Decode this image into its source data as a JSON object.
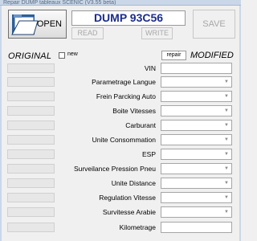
{
  "window": {
    "title": "Repair DUMP tableaux SCENIC (V3.55 beta)"
  },
  "toolbar": {
    "open_label": "OPEN",
    "read_label": "READ",
    "write_label": "WRITE",
    "save_label": "SAVE",
    "dump_title": "DUMP 93C56"
  },
  "columns": {
    "original": "ORIGINAL",
    "new_label": "new",
    "repair_label": "repair",
    "modified": "MODIFIED"
  },
  "fields": [
    {
      "label": "VIN",
      "type": "text"
    },
    {
      "label": "Parametrage Langue",
      "type": "dropdown"
    },
    {
      "label": "Frein Parcking Auto",
      "type": "dropdown"
    },
    {
      "label": "Boite Vitesses",
      "type": "dropdown"
    },
    {
      "label": "Carburant",
      "type": "dropdown"
    },
    {
      "label": "Unite Consommation",
      "type": "dropdown"
    },
    {
      "label": "ESP",
      "type": "dropdown"
    },
    {
      "label": "Surveilance Pression Pneu",
      "type": "dropdown"
    },
    {
      "label": "Unite Distance",
      "type": "dropdown"
    },
    {
      "label": "Regulation Vitesse",
      "type": "dropdown"
    },
    {
      "label": "Survitesse Arabie",
      "type": "dropdown"
    },
    {
      "label": "Kilometrage",
      "type": "text"
    }
  ],
  "icons": {
    "open": "folder-open-icon",
    "dropdown": "chevron-down-icon"
  }
}
